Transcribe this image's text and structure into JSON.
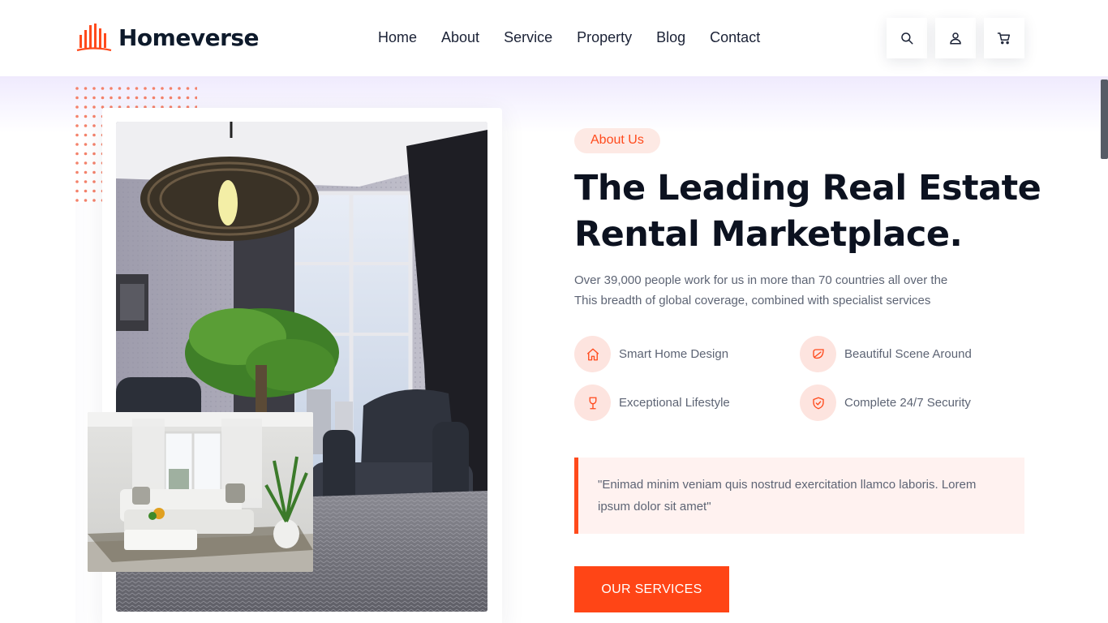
{
  "brand": {
    "name": "Homeverse",
    "accent": "#ff4a1c",
    "dark": "#0c1220"
  },
  "nav": {
    "items": [
      {
        "label": "Home"
      },
      {
        "label": "About"
      },
      {
        "label": "Service"
      },
      {
        "label": "Property"
      },
      {
        "label": "Blog"
      },
      {
        "label": "Contact"
      }
    ]
  },
  "header_actions": [
    {
      "icon": "search-icon"
    },
    {
      "icon": "user-icon"
    },
    {
      "icon": "cart-icon"
    }
  ],
  "about": {
    "badge": "About Us",
    "title_lines": [
      "The Leading Real Estate",
      "Rental Marketplace."
    ],
    "description_lines": [
      "Over 39,000 people work for us in more than 70 countries all over the",
      "This breadth of global coverage, combined with specialist services"
    ],
    "features": [
      {
        "icon": "home-icon",
        "label": "Smart Home Design"
      },
      {
        "icon": "leaf-icon",
        "label": "Beautiful Scene Around"
      },
      {
        "icon": "wine-glass-icon",
        "label": "Exceptional Lifestyle"
      },
      {
        "icon": "shield-check-icon",
        "label": "Complete 24/7 Security"
      }
    ],
    "quote_lines": [
      "\"Enimad minim veniam quis nostrud exercitation llamco laboris. Lorem",
      "ipsum dolor sit amet\""
    ],
    "cta_label": "OUR SERVICES"
  }
}
